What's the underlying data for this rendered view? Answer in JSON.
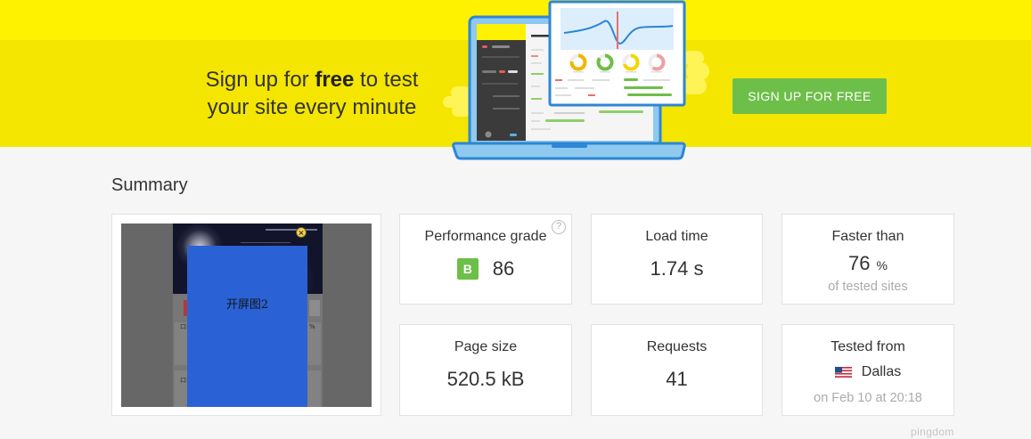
{
  "theme": {
    "banner_yellow": "#FFF200",
    "banner_band_yellow": "#F4E600",
    "cta_green": "#6EBF4A",
    "grade_green": "#6CBF48",
    "laptop_blue": "#2E86D4",
    "thumbnail_overlay_blue": "#2A62D6",
    "page_background": "#F6F6F6"
  },
  "banner": {
    "headline": {
      "line1_prefix": "Sign up for ",
      "line1_emphasis": "free",
      "line1_suffix": " to test",
      "line2": "your site every minute"
    },
    "cta_label": "SIGN UP FOR FREE",
    "illustration_icon": "laptop-dashboard-illustration"
  },
  "summary": {
    "title": "Summary",
    "screenshot": {
      "overlay_text": "开屏图2",
      "row_labels": [
        "口口",
        "口口"
      ],
      "percent_label": "%",
      "close_icon": "close-icon"
    },
    "performance": {
      "label": "Performance grade",
      "grade": "B",
      "score": 86,
      "help_icon": {
        "name": "question-circle-icon",
        "glyph": "?"
      }
    },
    "load_time": {
      "label": "Load time",
      "value": "1.74 s"
    },
    "faster_than": {
      "label": "Faster than",
      "value": 76,
      "unit": "%",
      "caption": "of tested sites"
    },
    "page_size": {
      "label": "Page size",
      "value": "520.5 kB"
    },
    "requests": {
      "label": "Requests",
      "value": 41
    },
    "tested_from": {
      "label": "Tested from",
      "location": "Dallas",
      "flag_icon": "us-flag-icon",
      "date": "on Feb 10 at 20:18"
    }
  },
  "footer": {
    "brand": "pingdom"
  }
}
